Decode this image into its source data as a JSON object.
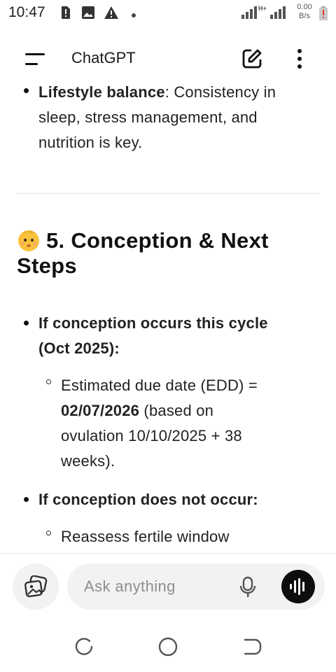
{
  "status_bar": {
    "time": "10:47",
    "network_type": "H+",
    "net_speed_value": "0.00",
    "net_speed_unit": "B/s"
  },
  "app_bar": {
    "title": "ChatGPT",
    "icons": [
      "menu-icon",
      "new-chat-icon",
      "more-vert-icon"
    ]
  },
  "message": {
    "lifestyle": {
      "label": "Lifestyle balance",
      "text": ": Consistency in",
      "line2": "sleep, stress management, and",
      "line3": "nutrition is key."
    },
    "section_heading": {
      "emoji": "baby-emoji",
      "line1": "5. Conception & Next",
      "line2": "Steps"
    },
    "bullet1": {
      "line1": "If conception occurs this cycle",
      "line2": "(Oct 2025):",
      "sub": {
        "line1": "Estimated due date (EDD) =",
        "date": "02/07/2026",
        "line2_rest": " (based on",
        "line3": "ovulation 10/10/2025 + 38",
        "line4": "weeks)."
      }
    },
    "bullet2": {
      "label": "If conception does not occur:",
      "sub_line1": "Reassess fertile window"
    }
  },
  "composer": {
    "placeholder": "Ask anything"
  },
  "colors": {
    "text": "#1f1f1f",
    "composer_bg": "#f2f2f2",
    "voice_button": "#0d0d0d",
    "placeholder": "#8d8d8d",
    "battery_alert": "#e53935"
  }
}
